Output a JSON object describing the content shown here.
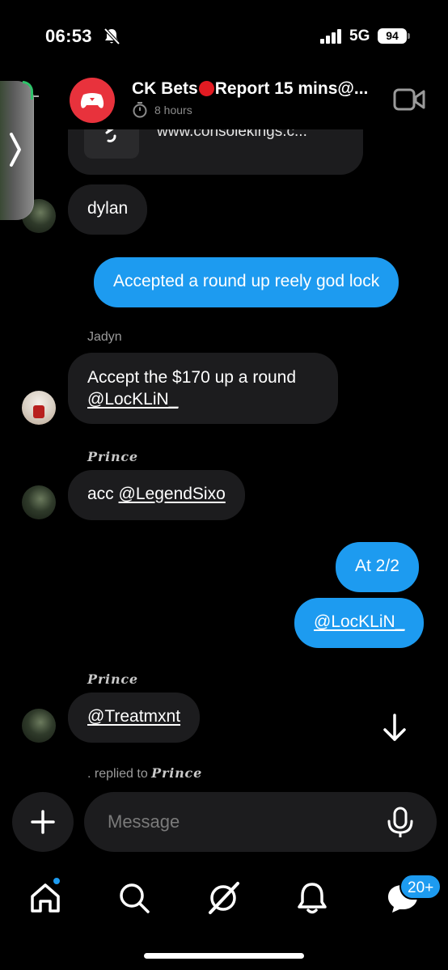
{
  "status_bar": {
    "time": "06:53",
    "network": "5G",
    "battery": "94"
  },
  "header": {
    "title_start": "CK Bets",
    "title_end": "Report 15 mins@...",
    "subtitle": "8 hours"
  },
  "link_card": {
    "url": "www.consolekings.c..."
  },
  "messages": [
    {
      "sender": "",
      "text": "dylan",
      "direction": "incoming"
    },
    {
      "text": "Accepted a round up reely god lock",
      "direction": "outgoing"
    },
    {
      "sender": "Jadyn",
      "text": "Accept the $170 up a round",
      "mention": "@LocKLiN_",
      "direction": "incoming"
    },
    {
      "sender": "Prince",
      "text": "acc",
      "mention": "@LegendSixo",
      "direction": "incoming"
    },
    {
      "text": "At 2/2",
      "direction": "outgoing"
    },
    {
      "mention": "@LocKLiN_",
      "direction": "outgoing"
    },
    {
      "sender": "Prince",
      "mention": "@Treatmxnt",
      "direction": "incoming"
    }
  ],
  "reply_note": {
    "prefix": ". replied to",
    "name": "Prince"
  },
  "composer": {
    "placeholder": "Message"
  },
  "nav": {
    "notifications_badge": "20+"
  },
  "colors": {
    "accent": "#1d9bf0",
    "incoming_bubble": "#1c1c1e",
    "group_avatar": "#e8323c"
  },
  "icons": [
    "muted-bell-icon",
    "signal-icon",
    "video-call-icon",
    "link-icon",
    "arrow-down-icon",
    "plus-icon",
    "microphone-icon",
    "home-icon",
    "search-icon",
    "grok-icon",
    "bell-icon",
    "messages-icon"
  ]
}
